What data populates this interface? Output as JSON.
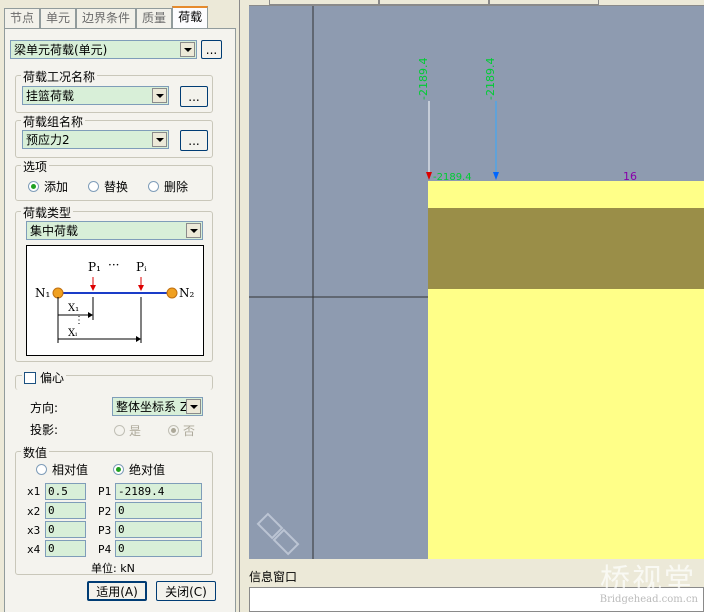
{
  "tabs": [
    {
      "label": "节点"
    },
    {
      "label": "单元"
    },
    {
      "label": "边界条件"
    },
    {
      "label": "质量"
    },
    {
      "label": "荷载",
      "active": true
    }
  ],
  "element_load_type": {
    "value": "梁单元荷载(单元)",
    "more_label": "..."
  },
  "load_case": {
    "title": "荷载工况名称",
    "value": "挂篮荷载",
    "more_label": "..."
  },
  "load_group": {
    "title": "荷载组名称",
    "value": "预应力2",
    "more_label": "..."
  },
  "options": {
    "title": "选项",
    "add": "添加",
    "replace": "替换",
    "delete": "删除",
    "selected": "add"
  },
  "load_type": {
    "title": "荷载类型",
    "value": "集中荷载"
  },
  "diagram": {
    "n1": "N₁",
    "n2": "N₂",
    "p1": "P₁",
    "pi": "Pᵢ",
    "dots": "···",
    "x1": "X₁",
    "xi": "Xᵢ"
  },
  "eccentric": {
    "label": "偏心",
    "checked": false
  },
  "direction": {
    "label": "方向:",
    "value": "整体坐标系 Z"
  },
  "projection": {
    "label": "投影:",
    "yes": "是",
    "no": "否",
    "selected": "no"
  },
  "values": {
    "title": "数值",
    "relative": "相对值",
    "absolute": "绝对值",
    "selected": "absolute",
    "rows": [
      {
        "xlabel": "x1",
        "x": "0.5",
        "plabel": "P1",
        "p": "-2189.4"
      },
      {
        "xlabel": "x2",
        "x": "0",
        "plabel": "P2",
        "p": "0"
      },
      {
        "xlabel": "x3",
        "x": "0",
        "plabel": "P3",
        "p": "0"
      },
      {
        "xlabel": "x4",
        "x": "0",
        "plabel": "P4",
        "p": "0"
      }
    ],
    "unit": "单位: kN"
  },
  "buttons": {
    "apply": "适用(A)",
    "close": "关闭(C)"
  },
  "canvas": {
    "load_label_1": "-2189.4",
    "load_label_2": "-2189.4",
    "element_number": "16",
    "node_label": "-2189.4"
  },
  "info_window": {
    "title": "信息窗口"
  },
  "watermark": {
    "main": "桥视堂",
    "sub": "Bridgehead.com.cn"
  },
  "colors": {
    "canvas_bg": "#8e9bb0",
    "beam_yellow": "#ffff88",
    "beam_band": "#9a8e48",
    "load_arrow": "#0066ff",
    "label_green": "#00cc33"
  }
}
